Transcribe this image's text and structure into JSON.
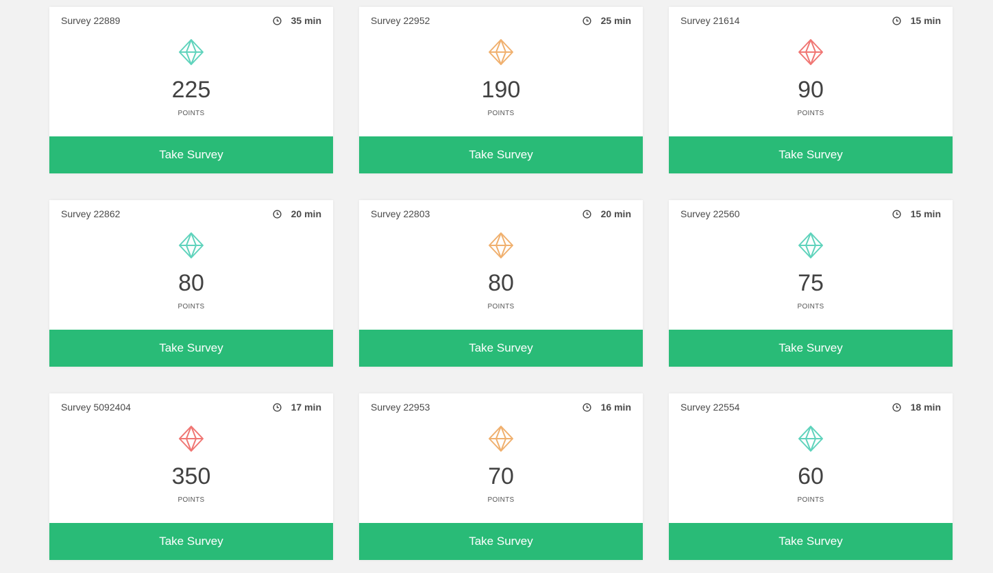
{
  "colors": {
    "background": "#f2f2f2",
    "button": "#29bb77",
    "teal": "#5fd3bc",
    "orange": "#f0b06e",
    "red": "#f07673"
  },
  "points_label": "POINTS",
  "button_label": "Take Survey",
  "surveys": [
    {
      "name": "Survey 22889",
      "duration": "35 min",
      "points": "225",
      "gem": "teal"
    },
    {
      "name": "Survey 22952",
      "duration": "25 min",
      "points": "190",
      "gem": "orange"
    },
    {
      "name": "Survey 21614",
      "duration": "15 min",
      "points": "90",
      "gem": "red"
    },
    {
      "name": "Survey 22862",
      "duration": "20 min",
      "points": "80",
      "gem": "teal"
    },
    {
      "name": "Survey 22803",
      "duration": "20 min",
      "points": "80",
      "gem": "orange"
    },
    {
      "name": "Survey 22560",
      "duration": "15 min",
      "points": "75",
      "gem": "teal"
    },
    {
      "name": "Survey 5092404",
      "duration": "17 min",
      "points": "350",
      "gem": "red"
    },
    {
      "name": "Survey 22953",
      "duration": "16 min",
      "points": "70",
      "gem": "orange"
    },
    {
      "name": "Survey 22554",
      "duration": "18 min",
      "points": "60",
      "gem": "teal"
    }
  ]
}
